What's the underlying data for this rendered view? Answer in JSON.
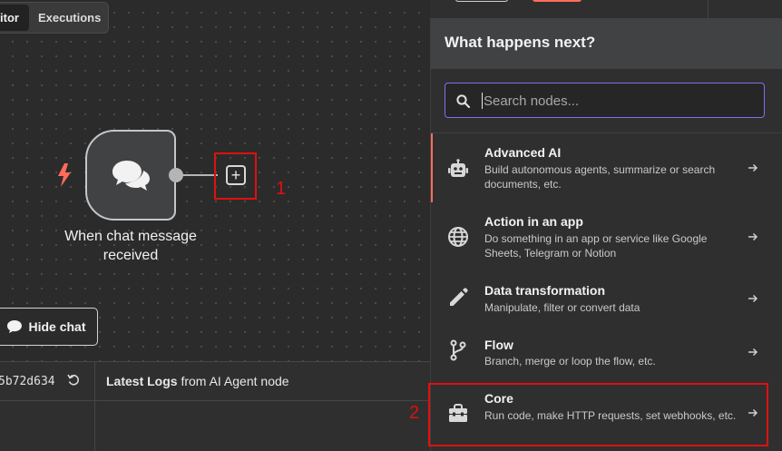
{
  "tabs": {
    "editor_label": "itor",
    "executions_label": "Executions"
  },
  "trigger_node": {
    "label": "When chat message received",
    "icon": "chat-bubbles-icon",
    "trigger_icon": "lightning-bolt-icon"
  },
  "canvas": {
    "add_button_icon": "plus-square-icon",
    "annotation_1": "1",
    "hide_chat_label": "Hide chat"
  },
  "logs": {
    "session_id": "5b72d634",
    "title_bold": "Latest Logs",
    "title_rest": " from AI Agent node"
  },
  "panel": {
    "title": "What happens next?",
    "search": {
      "placeholder": "Search nodes...",
      "value": ""
    },
    "categories": [
      {
        "title": "Advanced AI",
        "description": "Build autonomous agents, summarize or search documents, etc.",
        "icon": "robot-icon"
      },
      {
        "title": "Action in an app",
        "description": "Do something in an app or service like Google Sheets, Telegram or Notion",
        "icon": "globe-icon"
      },
      {
        "title": "Data transformation",
        "description": "Manipulate, filter or convert data",
        "icon": "pen-icon"
      },
      {
        "title": "Flow",
        "description": "Branch, merge or loop the flow, etc.",
        "icon": "git-branch-icon"
      },
      {
        "title": "Core",
        "description": "Run code, make HTTP requests, set webhooks, etc.",
        "icon": "toolbox-icon"
      }
    ],
    "annotation_2": "2"
  },
  "colors": {
    "accent": "#ff6d5a",
    "search_border": "#7d72e8",
    "annotation": "#e01010"
  }
}
